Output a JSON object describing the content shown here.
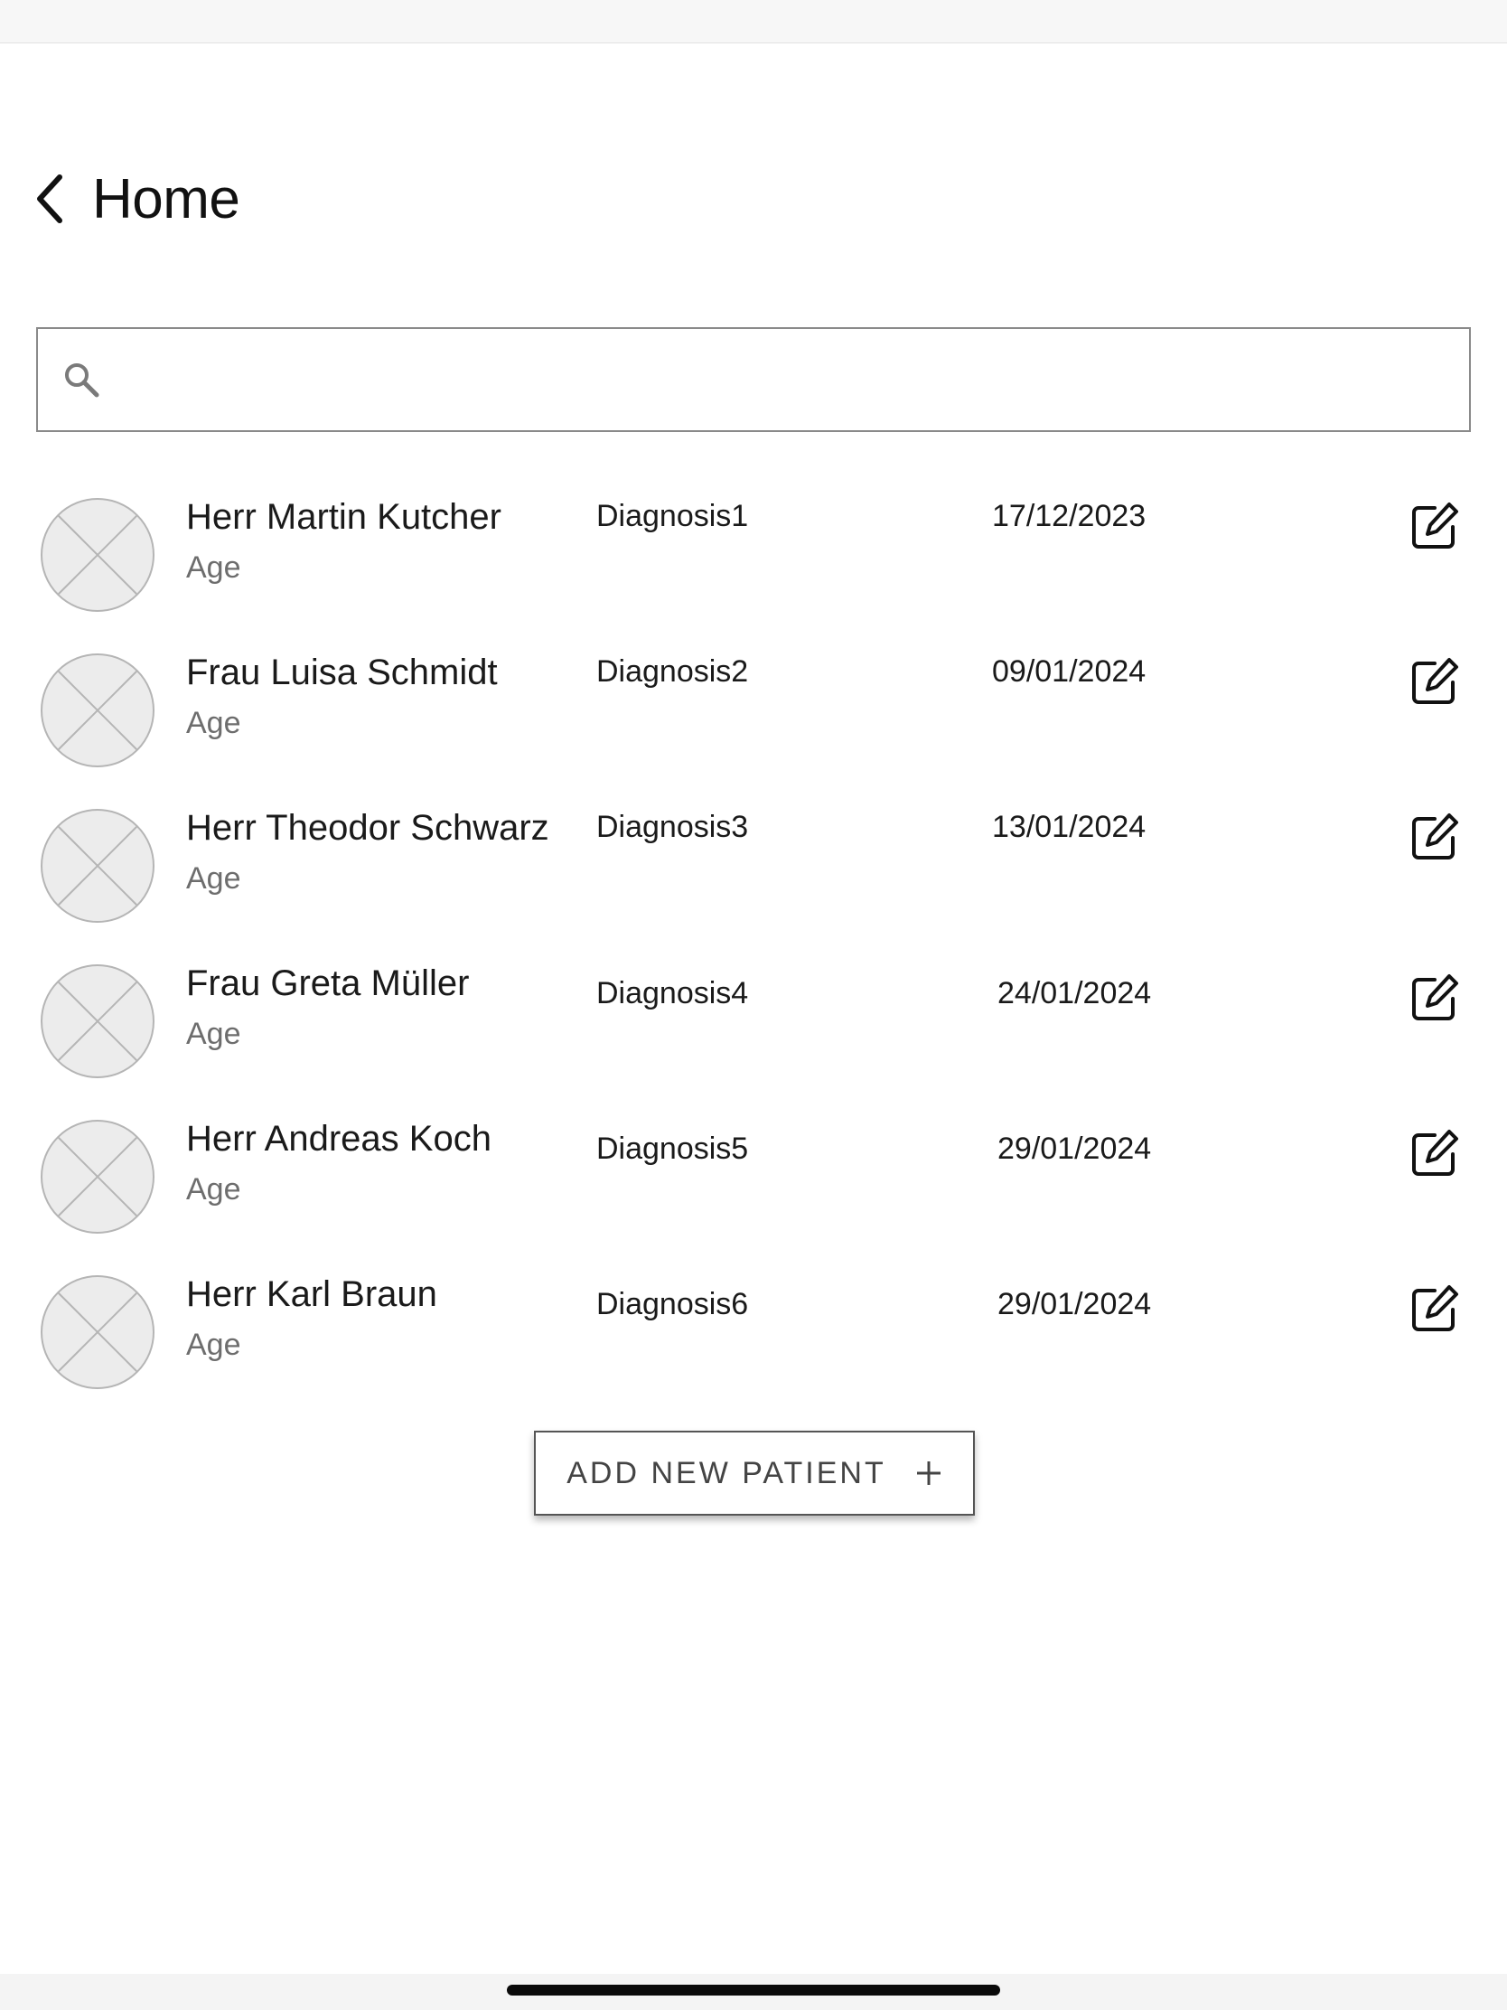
{
  "nav": {
    "back_label": "Home",
    "back_icon": "chevron-left-icon"
  },
  "search": {
    "placeholder": "",
    "value": "",
    "icon": "search-icon"
  },
  "patients": [
    {
      "name": "Herr Martin Kutcher",
      "age_label": "Age",
      "diagnosis": "Diagnosis1",
      "date": "17/12/2023"
    },
    {
      "name": "Frau Luisa Schmidt",
      "age_label": "Age",
      "diagnosis": "Diagnosis2",
      "date": "09/01/2024"
    },
    {
      "name": "Herr Theodor Schwarz",
      "age_label": "Age",
      "diagnosis": "Diagnosis3",
      "date": "13/01/2024"
    },
    {
      "name": "Frau Greta Müller",
      "age_label": "Age",
      "diagnosis": "Diagnosis4",
      "date": "24/01/2024"
    },
    {
      "name": "Herr Andreas Koch",
      "age_label": "Age",
      "diagnosis": "Diagnosis5",
      "date": "29/01/2024"
    },
    {
      "name": "Herr Karl Braun",
      "age_label": "Age",
      "diagnosis": "Diagnosis6",
      "date": "29/01/2024"
    }
  ],
  "add_button": {
    "label": "ADD NEW PATIENT",
    "icon": "plus-icon"
  },
  "colors": {
    "text": "#111111",
    "secondary_text": "#6d6d6d",
    "border": "#8a8a8a",
    "avatar_fill": "#ececec",
    "avatar_stroke": "#b5b5b5"
  }
}
